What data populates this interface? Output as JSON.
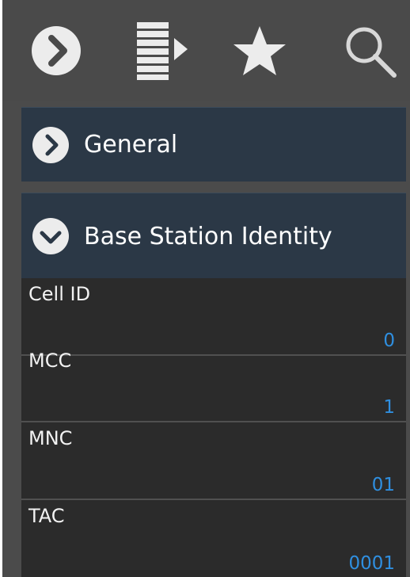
{
  "toolbar": {
    "buttons": [
      {
        "icon": "chevron-right-circle-icon"
      },
      {
        "icon": "list-play-icon"
      },
      {
        "icon": "star-icon"
      },
      {
        "icon": "search-icon"
      }
    ]
  },
  "sections": {
    "general": {
      "label": "General",
      "icon": "chevron-right-circle-icon",
      "expanded": false
    },
    "base_station": {
      "label": "Base Station Identity",
      "icon": "chevron-down-circle-icon",
      "expanded": true
    }
  },
  "fields": [
    {
      "label": "Cell ID",
      "value": "0"
    },
    {
      "label": "MCC",
      "value": "1"
    },
    {
      "label": "MNC",
      "value": "01"
    },
    {
      "label": "TAC",
      "value": "0001"
    }
  ],
  "colors": {
    "toolbar_bg": "#4a4a4a",
    "header_bg": "#2b3846",
    "row_bg": "#2b2b2b",
    "value_text": "#2f8fe0"
  }
}
